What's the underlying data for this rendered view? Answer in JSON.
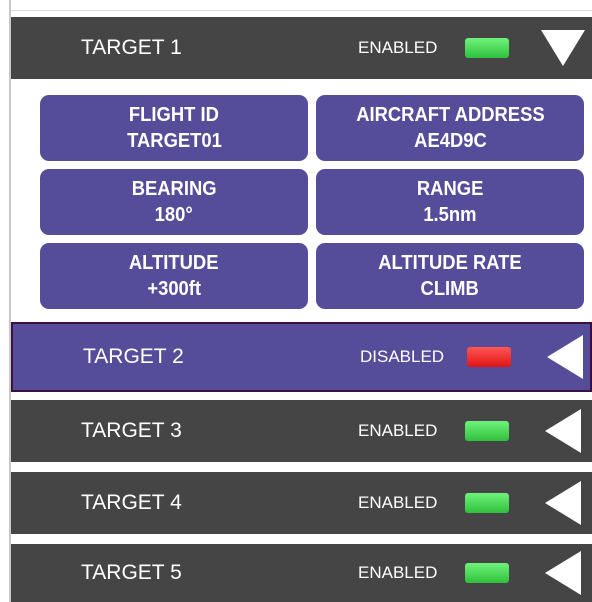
{
  "targets": [
    {
      "label": "TARGET 1",
      "status": "ENABLED",
      "status_color": "#36c744",
      "expanded": true
    },
    {
      "label": "TARGET 2",
      "status": "DISABLED",
      "status_color": "#e81c1c",
      "expanded": false,
      "selected": true
    },
    {
      "label": "TARGET 3",
      "status": "ENABLED",
      "status_color": "#36c744",
      "expanded": false
    },
    {
      "label": "TARGET 4",
      "status": "ENABLED",
      "status_color": "#36c744",
      "expanded": false
    },
    {
      "label": "TARGET 5",
      "status": "ENABLED",
      "status_color": "#36c744",
      "expanded": false
    }
  ],
  "details": {
    "flight_id": {
      "label": "FLIGHT ID",
      "value": "TARGET01"
    },
    "aircraft_address": {
      "label": "AIRCRAFT ADDRESS",
      "value": "AE4D9C"
    },
    "bearing": {
      "label": "BEARING",
      "value": "180°"
    },
    "range": {
      "label": "RANGE",
      "value": "1.5nm"
    },
    "altitude": {
      "label": "ALTITUDE",
      "value": "+300ft"
    },
    "altitude_rate": {
      "label": "ALTITUDE RATE",
      "value": "CLIMB"
    }
  },
  "colors": {
    "row_bg": "#454545",
    "accent_purple": "#554d99",
    "selected_border": "#3a1040",
    "enabled_led": "#36c744",
    "disabled_led": "#e81c1c"
  },
  "icons": {
    "expanded": "chevron-down-icon",
    "collapsed": "chevron-left-icon"
  }
}
